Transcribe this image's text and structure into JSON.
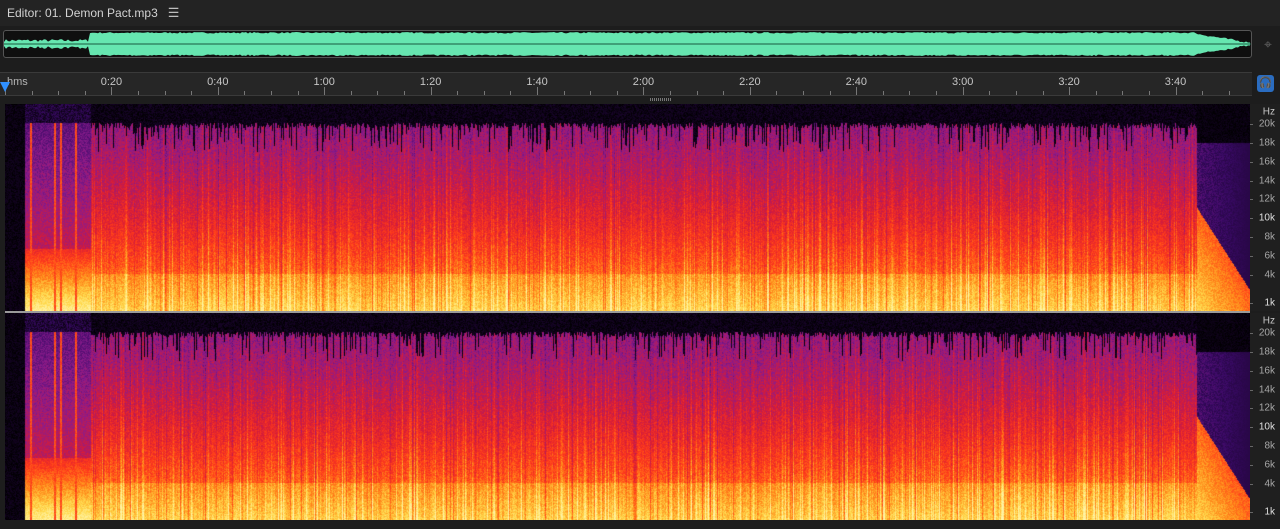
{
  "editor": {
    "title": "Editor: 01. Demon Pact.mp3",
    "menu_icon": "hamburger-icon"
  },
  "overview": {
    "waveform_color": "#66e6b0",
    "tail_color": "#9be8c8"
  },
  "ruler": {
    "unit_label": "hms",
    "ticks": [
      "0:20",
      "0:40",
      "1:00",
      "1:20",
      "1:40",
      "2:00",
      "2:20",
      "2:40",
      "3:00",
      "3:20",
      "3:40"
    ],
    "tick_seconds": [
      20,
      40,
      60,
      80,
      100,
      120,
      140,
      160,
      180,
      200,
      220
    ],
    "duration_seconds": 234
  },
  "playhead_color": "#2f8fff",
  "spectral": {
    "channels": 2,
    "intro_end_seconds": 16,
    "outro_start_seconds": 224,
    "colors": [
      "#000000",
      "#3a0a66",
      "#8a1b8c",
      "#d41b3a",
      "#ff3a1a",
      "#ff8a1a",
      "#ffd84a",
      "#fff4a8"
    ]
  },
  "freq_scale": {
    "unit": "Hz",
    "labels": [
      {
        "text": "20k",
        "khz": 20,
        "major": false
      },
      {
        "text": "18k",
        "khz": 18,
        "major": false
      },
      {
        "text": "16k",
        "khz": 16,
        "major": false
      },
      {
        "text": "14k",
        "khz": 14,
        "major": false
      },
      {
        "text": "12k",
        "khz": 12,
        "major": false
      },
      {
        "text": "10k",
        "khz": 10,
        "major": true
      },
      {
        "text": "8k",
        "khz": 8,
        "major": false
      },
      {
        "text": "6k",
        "khz": 6,
        "major": false
      },
      {
        "text": "4k",
        "khz": 4,
        "major": false
      },
      {
        "text": "1k",
        "khz": 1,
        "major": true
      }
    ]
  }
}
